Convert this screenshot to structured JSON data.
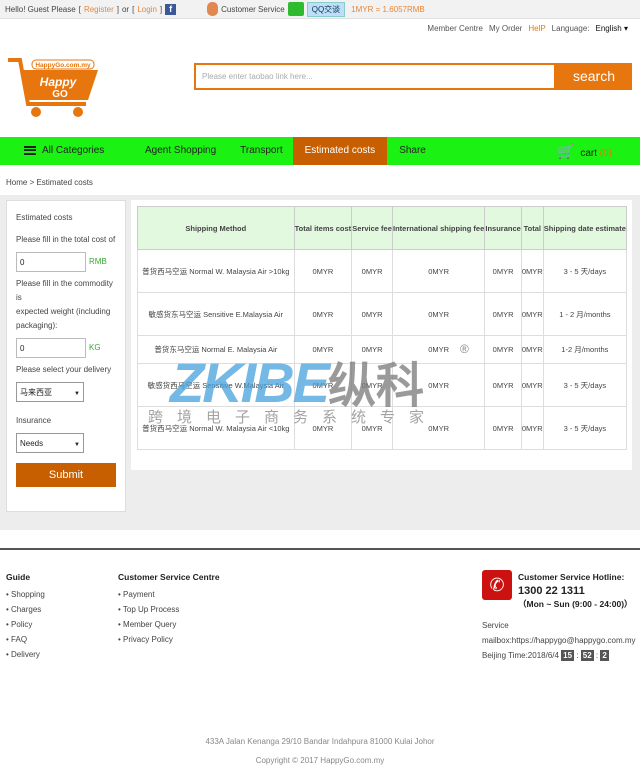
{
  "topbar": {
    "hello": "Hello! Guest Please",
    "register": "Register",
    "or": "or",
    "login": "Login",
    "customer_service": "Customer Service",
    "qq": "QQ交谈",
    "rate": "1MYR = 1.6057RMB"
  },
  "subbar": {
    "member_centre": "Member Centre",
    "my_order": "My Order",
    "help": "HelP",
    "language_label": "Language:",
    "language": "English"
  },
  "logo": {
    "text": "HappyGo.com.my",
    "brand": "Happy GO"
  },
  "search": {
    "placeholder": "Please enter taobao link here...",
    "button": "search"
  },
  "nav": {
    "all_categories": "All Categories",
    "items": [
      "Agent Shopping",
      "Transport",
      "Estimated costs",
      "Share"
    ],
    "active": "Estimated costs",
    "cart": "cart",
    "cart_count": "(0)"
  },
  "breadcrumb": "Home > Estimated costs",
  "side": {
    "title": "Estimated costs",
    "cost_label": "Please fill in the total cost of",
    "cost_value": "0",
    "cost_unit": "RMB",
    "weight_label1": "Please fill in the commodity is",
    "weight_label2": "expected weight (including packaging):",
    "weight_value": "0",
    "weight_unit": "KG",
    "delivery_label": "Please select your delivery",
    "delivery_value": "马来西亚",
    "insurance_label": "Insurance",
    "insurance_value": "Needs",
    "submit": "Submit"
  },
  "table": {
    "headers": [
      "Shipping Method",
      "Total items cost",
      "Service fee",
      "International shipping fee",
      "Insurance",
      "Total",
      "Shipping date estimate"
    ],
    "rows": [
      [
        "普货西马空运 Normal W. Malaysia Air >10kg",
        "0MYR",
        "0MYR",
        "0MYR",
        "0MYR",
        "0MYR",
        "3 - 5 天/days"
      ],
      [
        "敏感货东马空运 Sensitive E.Malaysia Air",
        "0MYR",
        "0MYR",
        "0MYR",
        "0MYR",
        "0MYR",
        "1 - 2 月/months"
      ],
      [
        "普货东马空运 Normal E. Malaysia Air",
        "0MYR",
        "0MYR",
        "0MYR",
        "0MYR",
        "0MYR",
        "1-2 月/months"
      ],
      [
        "敏感货西马空运 Sensitive W.Malaysia Air",
        "0MYR",
        "0MYR",
        "0MYR",
        "0MYR",
        "0MYR",
        "3 - 5 天/days"
      ],
      [
        "普货西马空运 Normal W. Malaysia Air <10kg",
        "0MYR",
        "0MYR",
        "0MYR",
        "0MYR",
        "0MYR",
        "3 - 5 天/days"
      ]
    ]
  },
  "watermark": {
    "brand": "ZKIBE",
    "cn": "纵科",
    "reg": "®",
    "tagline": "跨境电子商务系统专家"
  },
  "footer": {
    "guide": {
      "title": "Guide",
      "items": [
        "Shopping",
        "Charges",
        "Policy",
        "FAQ",
        "Delivery"
      ]
    },
    "csc": {
      "title": "Customer Service Centre",
      "items": [
        "Payment",
        "Top Up Process",
        "Member Query",
        "Privacy Policy"
      ]
    },
    "hotline_title": "Customer Service Hotline:",
    "hotline": "1300 22 1311",
    "hours": "（Mon ~ Sun (9:00 - 24:00)）",
    "mailbox": "Service mailbox:https://happygo@happygo.com.my",
    "beijing_label": "Beijing Time:2018/6/4",
    "hh": "15",
    "mm": "52",
    "ss": "2",
    "address": "433A Jalan Kenanga 29/10 Bandar Indahpura 81000 Kulai Johor",
    "copyright": "Copyright © 2017 HappyGo.com.my"
  },
  "colors": {
    "accent": "#e8760f",
    "nav": "#1bf112",
    "active": "#c75e00"
  }
}
